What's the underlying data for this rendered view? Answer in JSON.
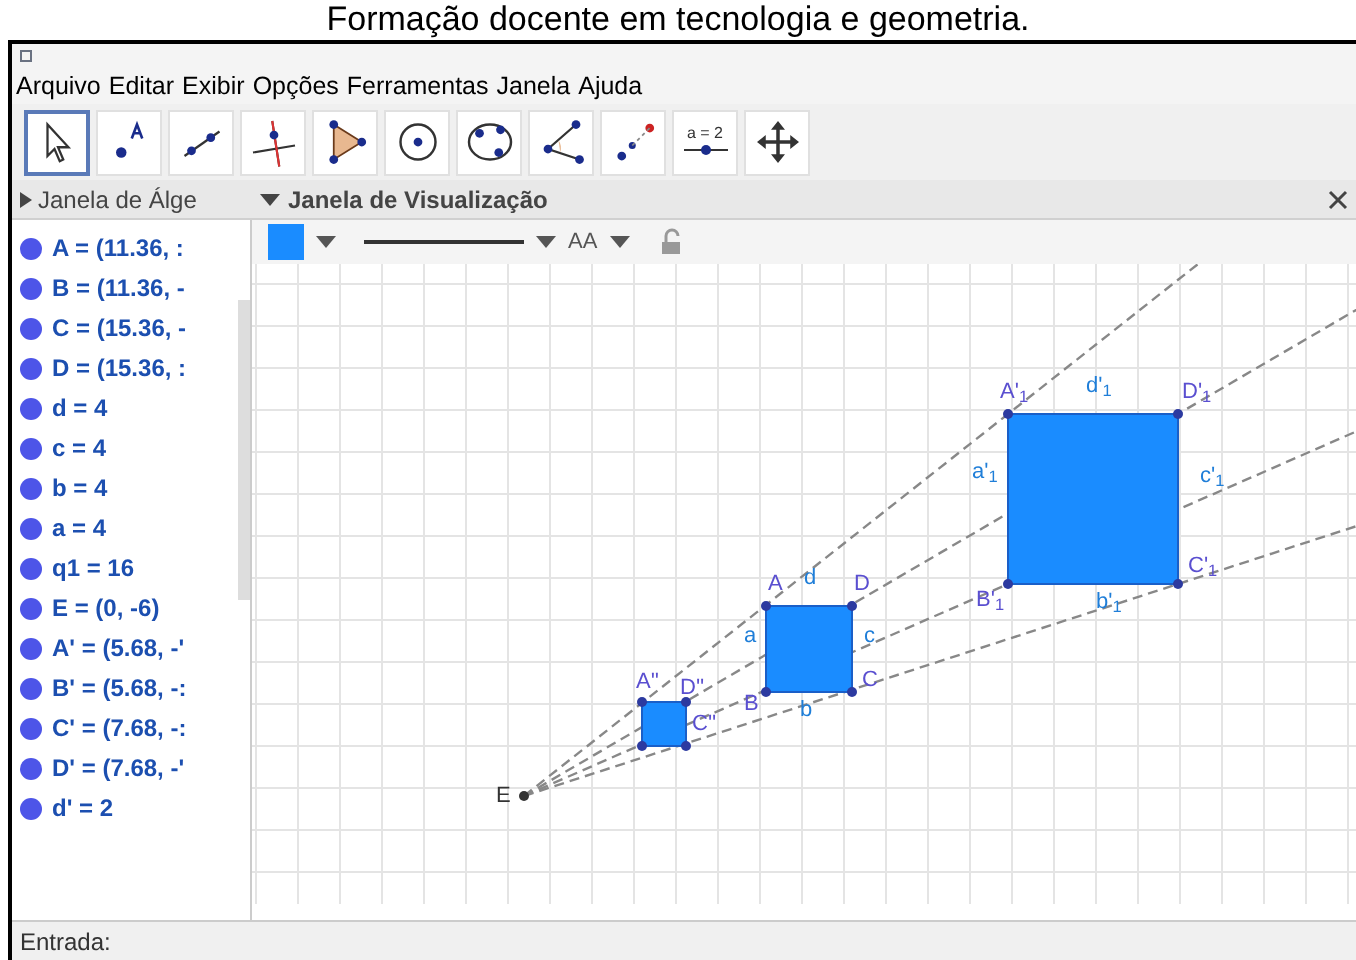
{
  "caption": "Formação docente em tecnologia e geometria.",
  "menu": [
    "Arquivo",
    "Editar",
    "Exibir",
    "Opções",
    "Ferramentas",
    "Janela",
    "Ajuda"
  ],
  "toolbar": [
    {
      "kind": "move",
      "selected": true
    },
    {
      "kind": "point",
      "selected": false
    },
    {
      "kind": "line",
      "selected": false
    },
    {
      "kind": "perpendicular",
      "selected": false
    },
    {
      "kind": "polygon",
      "selected": false
    },
    {
      "kind": "circle",
      "selected": false
    },
    {
      "kind": "conic",
      "selected": false
    },
    {
      "kind": "angle",
      "selected": false
    },
    {
      "kind": "reflect",
      "selected": false
    },
    {
      "kind": "slider",
      "selected": false,
      "label": "a = 2"
    },
    {
      "kind": "pan",
      "selected": false
    }
  ],
  "algebra_panel": {
    "title": "Janela de Álge",
    "items": [
      "A = (11.36, :",
      "B = (11.36, -",
      "C = (15.36, -",
      "D = (15.36, :",
      "d = 4",
      "c = 4",
      "b = 4",
      "a = 4",
      "q1 = 16",
      "E = (0, -6)",
      "A' = (5.68, -'",
      "B' = (5.68, -:",
      "C' = (7.68, -:",
      "D' = (7.68, -'",
      "d' = 2"
    ]
  },
  "graphics_panel": {
    "title": "Janela de Visualização",
    "style_bar": {
      "color": "#1a8cff",
      "label_style": "AA"
    },
    "labels": [
      "A'$_{1}$",
      "d'$_{1}$",
      "D'$_{1}$",
      "a'$_{1}$",
      "c'$_{1}$",
      "B'$_{1}$",
      "C'$_{1}$",
      "A",
      "d",
      "D",
      "b'$_{1}$",
      "a",
      "c",
      "B",
      "C",
      "b",
      "A''",
      "D''",
      "C''",
      "E"
    ]
  },
  "input_bar": {
    "label": "Entrada:"
  }
}
